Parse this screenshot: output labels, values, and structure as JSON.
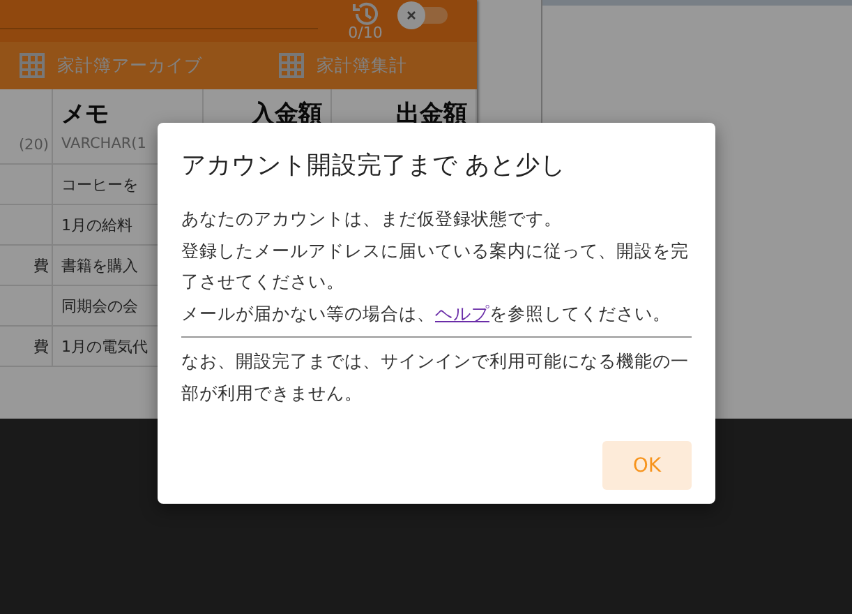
{
  "header": {
    "counter": "0/10",
    "toggle": {
      "on": false
    }
  },
  "tabs": [
    {
      "label": "家計簿アーカイブ"
    },
    {
      "label": "家計簿集計"
    }
  ],
  "table": {
    "columns": [
      {
        "type": "(20)"
      },
      {
        "name": "メモ",
        "type": "VARCHAR(1"
      },
      {
        "name": "入金額"
      },
      {
        "name": "出金額"
      }
    ],
    "rows": [
      {
        "memo": "コーヒーを"
      },
      {
        "memo": "1月の給料"
      },
      {
        "column_1": "費",
        "memo": "書籍を購入"
      },
      {
        "memo": "同期会の会"
      },
      {
        "column_1": "費",
        "memo": "1月の電気代"
      }
    ]
  },
  "dialog": {
    "title": "アカウント開設完了まで あと少し",
    "paragraphs": [
      {
        "text": "あなたのアカウントは、まだ仮登録状態です。"
      },
      {
        "text": "登録したメールアドレスに届いている案内に従って、開設を完了させてください。"
      },
      {
        "before": "メールが届かない等の場合は、",
        "link": "ヘルプ",
        "after": "を参照してください。"
      }
    ],
    "note": "なお、開設完了までは、サインインで利用可能になる機能の一部が利用できません。",
    "buttons": [
      "OK"
    ]
  }
}
